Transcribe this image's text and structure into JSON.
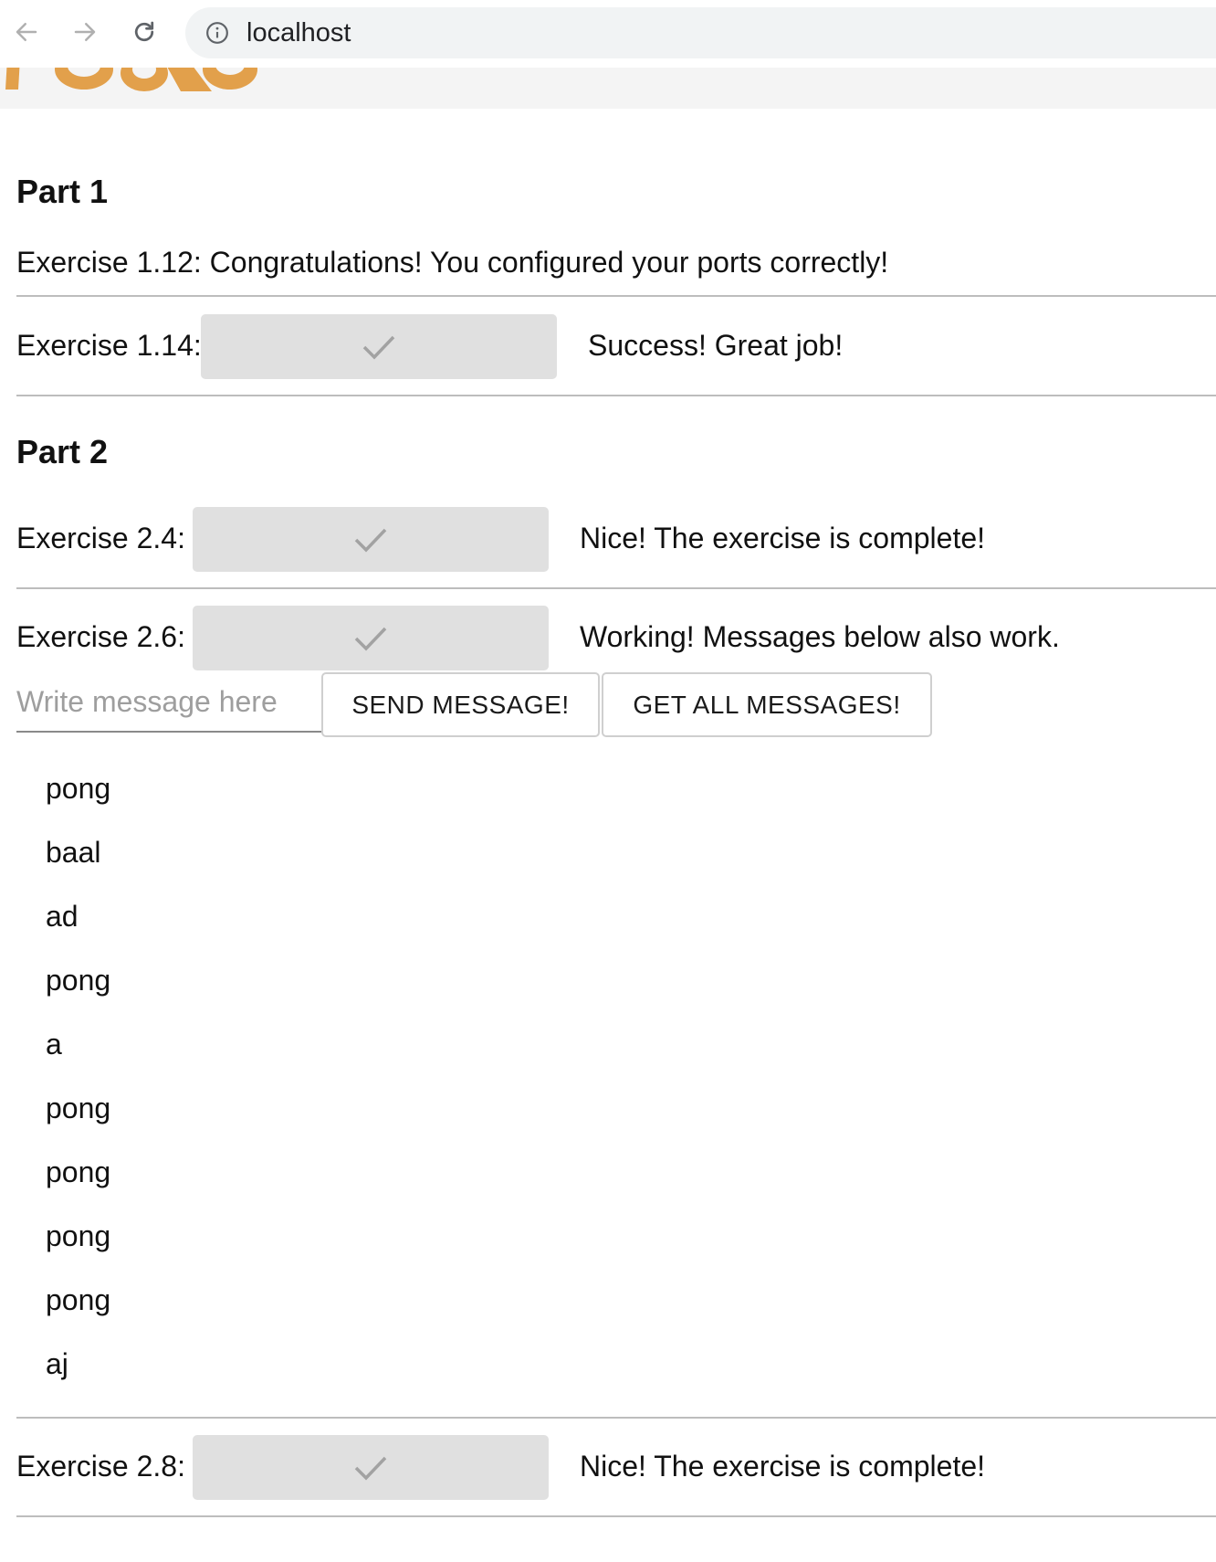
{
  "browser": {
    "url": "localhost"
  },
  "colors": {
    "banner_accent": "#e2a04b",
    "button_gray": "#e0e0e0"
  },
  "part1": {
    "title": "Part 1",
    "exercise_1_12": "Exercise 1.12: Congratulations! You configured your ports correctly!",
    "exercise_1_14": {
      "label": "Exercise 1.14:",
      "status": "Success! Great job!",
      "button_icon": "checkmark-icon"
    }
  },
  "part2": {
    "title": "Part 2",
    "exercise_2_4": {
      "label": "Exercise 2.4:",
      "status": "Nice! The exercise is complete!",
      "button_icon": "checkmark-icon"
    },
    "exercise_2_6": {
      "label": "Exercise 2.6:",
      "status": "Working! Messages below also work.",
      "button_icon": "checkmark-icon",
      "input_placeholder": "Write message here",
      "input_value": "",
      "send_label": "SEND MESSAGE!",
      "get_all_label": "GET ALL MESSAGES!",
      "messages": [
        "pong",
        "baal",
        "ad",
        "pong",
        "a",
        "pong",
        "pong",
        "pong",
        "pong",
        "aj"
      ]
    },
    "exercise_2_8": {
      "label": "Exercise 2.8:",
      "status": "Nice! The exercise is complete!",
      "button_icon": "checkmark-icon"
    }
  }
}
